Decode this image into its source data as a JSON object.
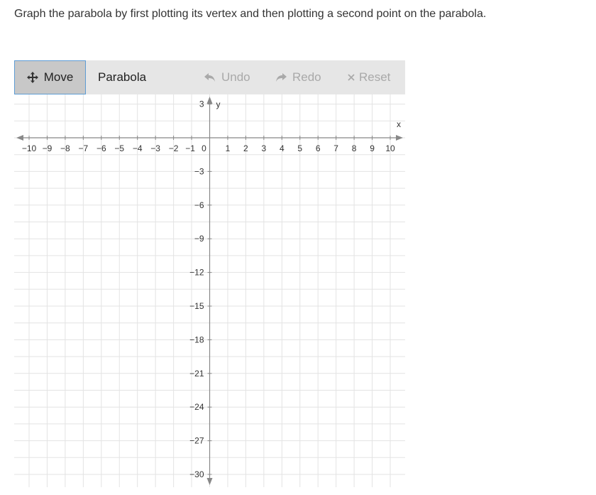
{
  "prompt": "Graph the parabola by first plotting its vertex and then plotting a second point on the parabola.",
  "toolbar": {
    "move_label": "Move",
    "move_icon": "move-arrows-icon",
    "parabola_label": "Parabola",
    "undo_label": "Undo",
    "undo_icon": "undo-arrow-icon",
    "redo_label": "Redo",
    "redo_icon": "redo-arrow-icon",
    "reset_label": "Reset",
    "reset_icon": "x-icon",
    "selected_tool": "Move"
  },
  "graph": {
    "x_axis_label": "x",
    "y_axis_label": "y",
    "x_range": [
      -10,
      10
    ],
    "y_range": [
      -30,
      3
    ],
    "x_ticks": [
      "−10",
      "−9",
      "−8",
      "−7",
      "−6",
      "−5",
      "−4",
      "−3",
      "−2",
      "−1",
      "0",
      "1",
      "2",
      "3",
      "4",
      "5",
      "6",
      "7",
      "8",
      "9",
      "10"
    ],
    "y_ticks": [
      "3",
      "−3",
      "−6",
      "−9",
      "−12",
      "−15",
      "−18",
      "−21",
      "−24",
      "−27",
      "−30"
    ],
    "colors": {
      "grid": "#e3e3e3",
      "axis": "#888888",
      "label": "#333333",
      "move_border": "#5d9bd3"
    }
  }
}
